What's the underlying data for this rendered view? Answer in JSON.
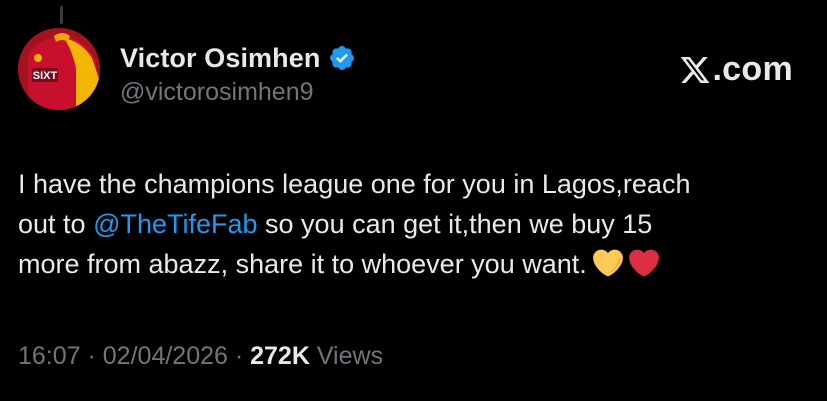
{
  "author": {
    "display_name": "Victor Osimhen",
    "handle": "@victorosimhen9",
    "verified": true,
    "avatar_icon": "jersey-avatar"
  },
  "brand": {
    "label": ".com",
    "icon": "x-logo-icon"
  },
  "tweet": {
    "line1": "I have the champions league one for you in Lagos,reach",
    "line2_prefix": "out to ",
    "mention": "@TheTifeFab",
    "line2_suffix": " so you can get it,then we buy 15",
    "line3": "more from abazz, share it to whoever you want.",
    "emojis": [
      "yellow-heart-icon",
      "red-heart-icon"
    ]
  },
  "meta": {
    "time": "16:07",
    "separator": " · ",
    "date": "02/04/2026",
    "views_count": "272K",
    "views_label": " Views"
  },
  "colors": {
    "background": "#000000",
    "text": "#e7e9ea",
    "muted": "#71767b",
    "accent": "#1d9bf0",
    "avatar_red": "#c8102e",
    "avatar_yellow": "#f2b705"
  }
}
